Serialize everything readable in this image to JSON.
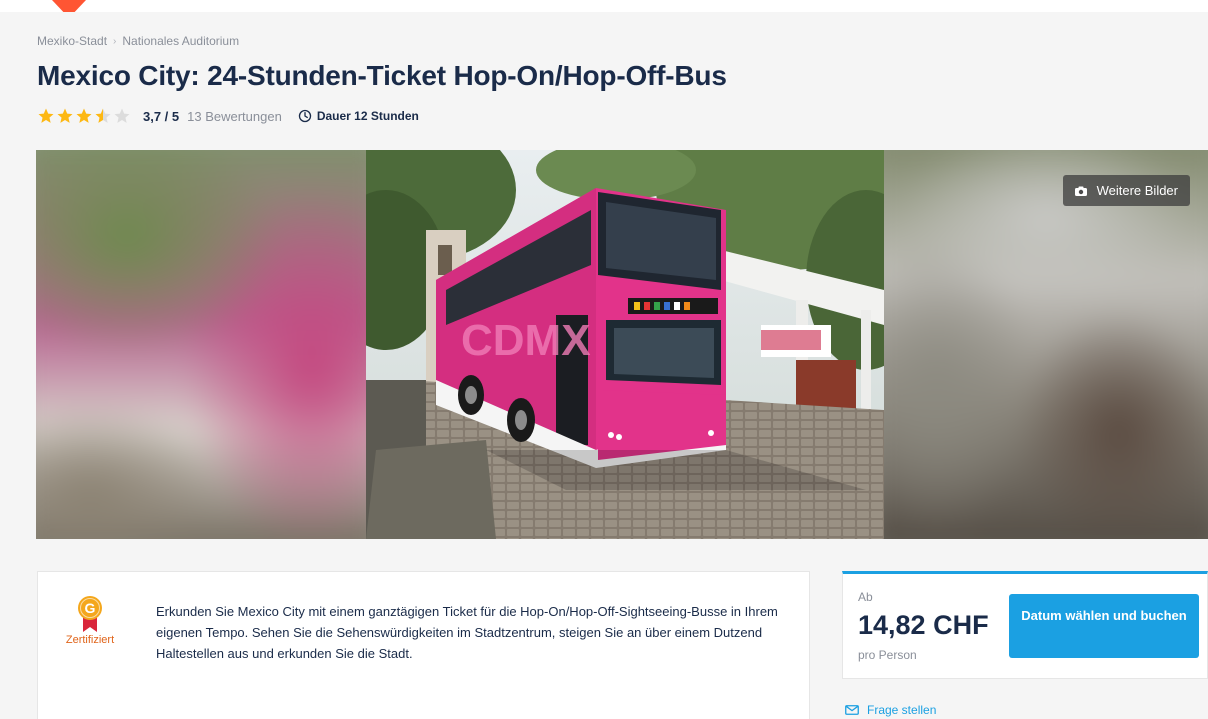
{
  "breadcrumb": {
    "items": [
      "Mexiko-Stadt",
      "Nationales Auditorium"
    ],
    "separator": "›"
  },
  "title": "Mexico City: 24-Stunden-Ticket Hop-On/Hop-Off-Bus",
  "rating": {
    "stars_value": 3.7,
    "stars_max": 5,
    "value_text": "3,7 / 5",
    "reviews_text": "13 Bewertungen"
  },
  "duration": {
    "text": "Dauer 12 Stunden",
    "icon": "clock-icon"
  },
  "gallery": {
    "more_images_label": "Weitere Bilder",
    "more_images_icon": "camera-icon",
    "main_image": "pink double-decker bus (CAPITALBUS, CDMX) parked on a cobblestone plaza"
  },
  "description": {
    "badge_letter": "G",
    "badge_label": "Zertifiziert",
    "text": "Erkunden Sie Mexico City mit einem ganztägigen Ticket für die Hop-On/Hop-Off-Sightseeing-Busse in Ihrem eigenen Tempo. Sehen Sie die Sehenswürdigkeiten im Stadtzentrum, steigen Sie an über einem Dutzend Haltestellen aus und erkunden Sie die Stadt."
  },
  "booking": {
    "from_label": "Ab",
    "price": "14,82 CHF",
    "per_person": "pro Person",
    "button_label": "Datum wählen und buchen"
  },
  "ask_question": {
    "label": "Frage stellen",
    "icon": "envelope-icon"
  },
  "colors": {
    "brand_orange": "#ff5533",
    "accent_blue": "#1ba0e2",
    "star": "#fdb813",
    "text_dark": "#1a2b49",
    "text_muted": "#8a8f99"
  }
}
